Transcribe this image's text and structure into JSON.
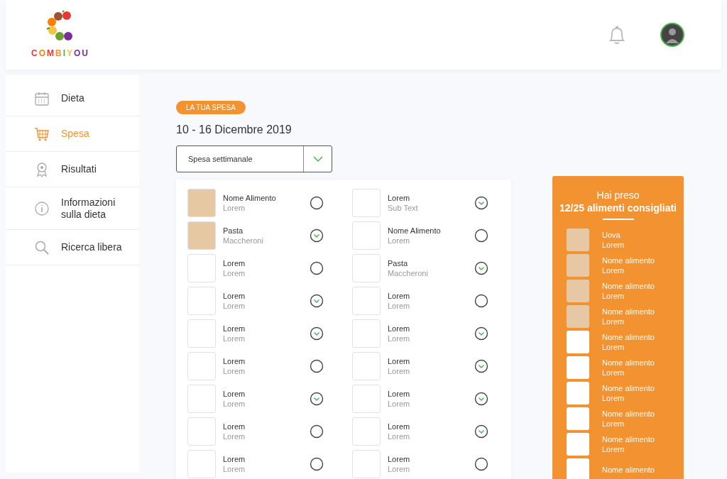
{
  "brand": {
    "name": "COMBIYOU"
  },
  "sidebar": {
    "items": [
      {
        "label": "Dieta",
        "selected": false
      },
      {
        "label": "Spesa",
        "selected": true
      },
      {
        "label": "Risultati",
        "selected": false
      },
      {
        "label": "Informazioni sulla dieta",
        "selected": false
      },
      {
        "label": "Ricerca libera",
        "selected": false
      }
    ]
  },
  "header": {
    "tag": "LA TUA SPESA",
    "title": "10 - 16 Dicembre 2019",
    "select": {
      "value": "Spesa settimanale"
    }
  },
  "list_columns": [
    [
      {
        "name": "Nome Alimento",
        "sub": "Lorem",
        "photo": true,
        "checked": false
      },
      {
        "name": "Pasta",
        "sub": "Maccheroni",
        "photo": true,
        "checked": true
      },
      {
        "name": "Lorem",
        "sub": "Lorem",
        "photo": false,
        "checked": false
      },
      {
        "name": "Lorem",
        "sub": "Lorem",
        "photo": false,
        "checked": true
      },
      {
        "name": "Lorem",
        "sub": "Lorem",
        "photo": false,
        "checked": true
      },
      {
        "name": "Lorem",
        "sub": "Lorem",
        "photo": false,
        "checked": false
      },
      {
        "name": "Lorem",
        "sub": "Lorem",
        "photo": false,
        "checked": true
      },
      {
        "name": "Lorem",
        "sub": "Lorem",
        "photo": false,
        "checked": false
      },
      {
        "name": "Lorem",
        "sub": "Lorem",
        "photo": false,
        "checked": false
      }
    ],
    [
      {
        "name": "Lorem",
        "sub": "Sub Text",
        "photo": false,
        "checked": true
      },
      {
        "name": "Nome Alimento",
        "sub": "Lorem",
        "photo": false,
        "checked": false
      },
      {
        "name": "Pasta",
        "sub": "Maccheroni",
        "photo": false,
        "checked": true
      },
      {
        "name": "Lorem",
        "sub": "Lorem",
        "photo": false,
        "checked": false
      },
      {
        "name": "Lorem",
        "sub": "Lorem",
        "photo": false,
        "checked": true
      },
      {
        "name": "Lorem",
        "sub": "Lorem",
        "photo": false,
        "checked": true
      },
      {
        "name": "Lorem",
        "sub": "Lorem",
        "photo": false,
        "checked": true
      },
      {
        "name": "Lorem",
        "sub": "Lorem",
        "photo": false,
        "checked": true
      },
      {
        "name": "Lorem",
        "sub": "Lorem",
        "photo": false,
        "checked": false
      }
    ]
  ],
  "summary": {
    "title_line1": "Hai preso",
    "title_line2": "12/25 alimenti consigliati",
    "items": [
      {
        "name": "Uova",
        "sub": "Lorem",
        "photo": true
      },
      {
        "name": "Nome alimento",
        "sub": "Lorem",
        "photo": true
      },
      {
        "name": "Nome alimento",
        "sub": "Lorem",
        "photo": true
      },
      {
        "name": "Nome alimento",
        "sub": "Lorem",
        "photo": true
      },
      {
        "name": "Nome alimento",
        "sub": "Lorem",
        "photo": false
      },
      {
        "name": "Nome alimento",
        "sub": "Lorem",
        "photo": false
      },
      {
        "name": "Nome alimento",
        "sub": "Lorem",
        "photo": false
      },
      {
        "name": "Nome alimento",
        "sub": "Lorem",
        "photo": false
      },
      {
        "name": "Nome alimento",
        "sub": "Lorem",
        "photo": false
      },
      {
        "name": "Nome alimento",
        "photo": false
      }
    ]
  }
}
